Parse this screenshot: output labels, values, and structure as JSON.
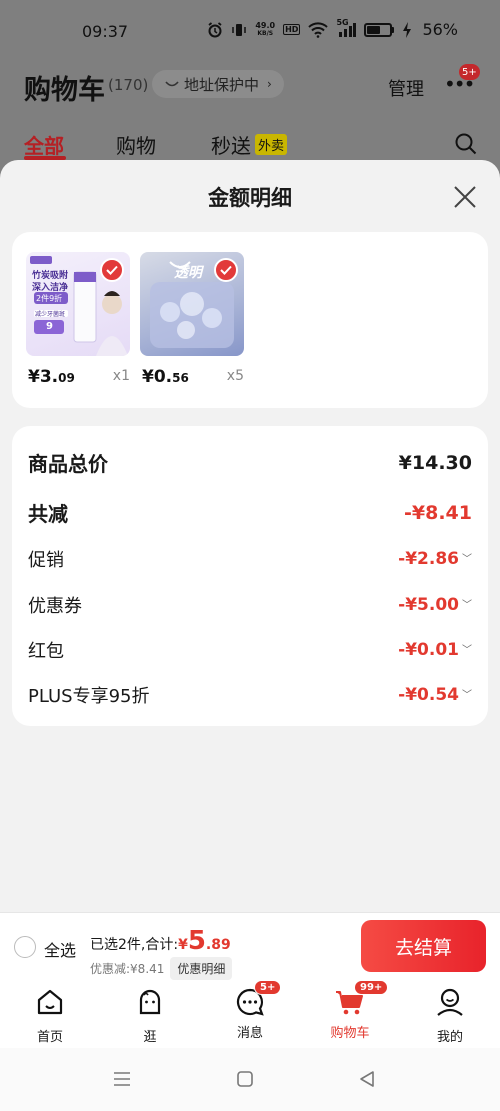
{
  "status_bar": {
    "time": "09:37",
    "net_speed_top": "49.0",
    "net_speed_bottom": "KB/S",
    "hd": "HD",
    "network": "5G",
    "battery_percent": "56%",
    "battery_level": 0.56
  },
  "header": {
    "title": "购物车",
    "count": "(170)",
    "address_protection": "地址保护中",
    "manage": "管理",
    "more_badge": "5+"
  },
  "tabs": [
    {
      "label": "全部",
      "active": true
    },
    {
      "label": "购物",
      "active": false
    },
    {
      "label": "秒送",
      "tag": "外卖",
      "active": false
    }
  ],
  "sheet": {
    "title": "金额明细",
    "products": [
      {
        "price_int": "¥3.",
        "price_dec": "09",
        "qty": "x1",
        "image": "toothpaste-product-image",
        "img_text_1": "竹炭吸附",
        "img_text_2": "深入洁净",
        "img_text_3": "2件9折",
        "img_text_4": "减少牙菌斑",
        "img_price": "9"
      },
      {
        "price_int": "¥0.",
        "price_dec": "56",
        "qty": "x5",
        "image": "hair-clip-product-image",
        "img_text_1": "透明"
      }
    ],
    "summary": {
      "total_label": "商品总价",
      "total_value": "¥14.30",
      "reduction_label": "共减",
      "reduction_value": "-¥8.41",
      "items": [
        {
          "label": "促销",
          "value": "-¥2.86"
        },
        {
          "label": "优惠券",
          "value": "-¥5.00"
        },
        {
          "label": "红包",
          "value": "-¥0.01"
        },
        {
          "label": "PLUS专享95折",
          "value": "-¥0.54"
        }
      ]
    }
  },
  "checkout": {
    "select_all": "全选",
    "selected_summary": "已选2件,合计:",
    "total_currency": "¥",
    "total_int": "5",
    "total_dec": ".89",
    "discount_text": "优惠减:¥8.41",
    "detail_button": "优惠明细",
    "checkout_button": "去结算"
  },
  "bottom_nav": [
    {
      "label": "首页",
      "icon": "home-icon"
    },
    {
      "label": "逛",
      "icon": "browse-face-icon"
    },
    {
      "label": "消息",
      "icon": "message-icon",
      "badge": "5+"
    },
    {
      "label": "购物车",
      "icon": "cart-icon",
      "badge": "99+",
      "active": true
    },
    {
      "label": "我的",
      "icon": "profile-icon"
    }
  ],
  "colors": {
    "accent_red": "#e2392f",
    "header_red": "#b52024",
    "dim_overlay": "#7f7f7f"
  }
}
